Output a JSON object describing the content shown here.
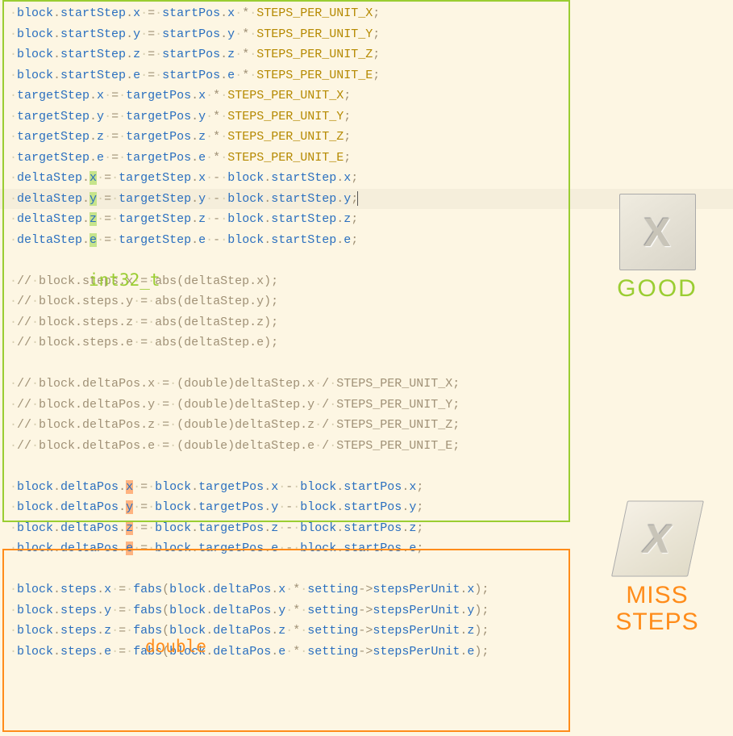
{
  "ws_dot": "·",
  "labels": {
    "int32": "int32_t",
    "double": "double",
    "good": "GOOD",
    "bad_l1": "MISS",
    "bad_l2": "STEPS"
  },
  "top_block_lines": [
    {
      "obj": "block.startStep",
      "member": "x",
      "eq": " = ",
      "rhs_obj": "startPos",
      "rhs_member": "x",
      "op": " * ",
      "const": "STEPS_PER_UNIT_X",
      "hl": false
    },
    {
      "obj": "block.startStep",
      "member": "y",
      "eq": " = ",
      "rhs_obj": "startPos",
      "rhs_member": "y",
      "op": " * ",
      "const": "STEPS_PER_UNIT_Y",
      "hl": false
    },
    {
      "obj": "block.startStep",
      "member": "z",
      "eq": " = ",
      "rhs_obj": "startPos",
      "rhs_member": "z",
      "op": " * ",
      "const": "STEPS_PER_UNIT_Z",
      "hl": false
    },
    {
      "obj": "block.startStep",
      "member": "e",
      "eq": " = ",
      "rhs_obj": "startPos",
      "rhs_member": "e",
      "op": " * ",
      "const": "STEPS_PER_UNIT_E",
      "hl": false
    },
    {
      "obj": "targetStep",
      "member": "x",
      "eq": " = ",
      "rhs_obj": "targetPos",
      "rhs_member": "x",
      "op": " * ",
      "const": "STEPS_PER_UNIT_X",
      "hl": false
    },
    {
      "obj": "targetStep",
      "member": "y",
      "eq": " = ",
      "rhs_obj": "targetPos",
      "rhs_member": "y",
      "op": " * ",
      "const": "STEPS_PER_UNIT_Y",
      "hl": false
    },
    {
      "obj": "targetStep",
      "member": "z",
      "eq": " = ",
      "rhs_obj": "targetPos",
      "rhs_member": "z",
      "op": " * ",
      "const": "STEPS_PER_UNIT_Z",
      "hl": false
    },
    {
      "obj": "targetStep",
      "member": "e",
      "eq": " = ",
      "rhs_obj": "targetPos",
      "rhs_member": "e",
      "op": " * ",
      "const": "STEPS_PER_UNIT_E",
      "hl": false
    },
    {
      "obj": "deltaStep",
      "member": "x",
      "eq": " = ",
      "rhs_obj": "targetStep",
      "rhs_member": "x",
      "op": " - ",
      "rhs2_obj": "block.startStep",
      "rhs2_member": "x",
      "hl": true
    },
    {
      "obj": "deltaStep",
      "member": "y",
      "eq": " = ",
      "rhs_obj": "targetStep",
      "rhs_member": "y",
      "op": " - ",
      "rhs2_obj": "block.startStep",
      "rhs2_member": "y",
      "hl": true,
      "cursor": true
    },
    {
      "obj": "deltaStep",
      "member": "z",
      "eq": " = ",
      "rhs_obj": "targetStep",
      "rhs_member": "z",
      "op": " - ",
      "rhs2_obj": "block.startStep",
      "rhs2_member": "z",
      "hl": true
    },
    {
      "obj": "deltaStep",
      "member": "e",
      "eq": " = ",
      "rhs_obj": "targetStep",
      "rhs_member": "e",
      "op": " - ",
      "rhs2_obj": "block.startStep",
      "rhs2_member": "e",
      "hl": true
    }
  ],
  "comment_steps": [
    "// block.steps.x = abs(deltaStep.x);",
    "// block.steps.y = abs(deltaStep.y);",
    "// block.steps.z = abs(deltaStep.z);",
    "// block.steps.e = abs(deltaStep.e);"
  ],
  "comment_delta": [
    "// block.deltaPos.x = (double)deltaStep.x / STEPS_PER_UNIT_X;",
    "// block.deltaPos.y = (double)deltaStep.y / STEPS_PER_UNIT_Y;",
    "// block.deltaPos.z = (double)deltaStep.z / STEPS_PER_UNIT_Z;",
    "// block.deltaPos.e = (double)deltaStep.e / STEPS_PER_UNIT_E;"
  ],
  "bottom_delta_lines": [
    {
      "obj": "block.deltaPos",
      "member": "x",
      "eq": " = ",
      "rhs_obj": "block.targetPos",
      "rhs_member": "x",
      "op": " - ",
      "rhs2_obj": "block.startPos",
      "rhs2_member": "x",
      "hl": true
    },
    {
      "obj": "block.deltaPos",
      "member": "y",
      "eq": " = ",
      "rhs_obj": "block.targetPos",
      "rhs_member": "y",
      "op": " - ",
      "rhs2_obj": "block.startPos",
      "rhs2_member": "y",
      "hl": true
    },
    {
      "obj": "block.deltaPos",
      "member": "z",
      "eq": " = ",
      "rhs_obj": "block.targetPos",
      "rhs_member": "z",
      "op": " - ",
      "rhs2_obj": "block.startPos",
      "rhs2_member": "z",
      "hl": true
    },
    {
      "obj": "block.deltaPos",
      "member": "e",
      "eq": " = ",
      "rhs_obj": "block.targetPos",
      "rhs_member": "e",
      "op": " - ",
      "rhs2_obj": "block.startPos",
      "rhs2_member": "e",
      "hl": true
    }
  ],
  "bottom_steps_lines": [
    {
      "obj": "block.steps",
      "member": "x",
      "eq": " = ",
      "fn": "fabs",
      "arg_obj": "block.deltaPos",
      "arg_member": "x",
      "op": " * ",
      "rhs_obj": "setting->stepsPerUnit",
      "rhs_member": "x"
    },
    {
      "obj": "block.steps",
      "member": "y",
      "eq": " = ",
      "fn": "fabs",
      "arg_obj": "block.deltaPos",
      "arg_member": "y",
      "op": " * ",
      "rhs_obj": "setting->stepsPerUnit",
      "rhs_member": "y"
    },
    {
      "obj": "block.steps",
      "member": "z",
      "eq": " = ",
      "fn": "fabs",
      "arg_obj": "block.deltaPos",
      "arg_member": "z",
      "op": " * ",
      "rhs_obj": "setting->stepsPerUnit",
      "rhs_member": "z"
    },
    {
      "obj": "block.steps",
      "member": "e",
      "eq": " = ",
      "fn": "fabs",
      "arg_obj": "block.deltaPos",
      "arg_member": "e",
      "op": " * ",
      "rhs_obj": "setting->stepsPerUnit",
      "rhs_member": "e"
    }
  ]
}
